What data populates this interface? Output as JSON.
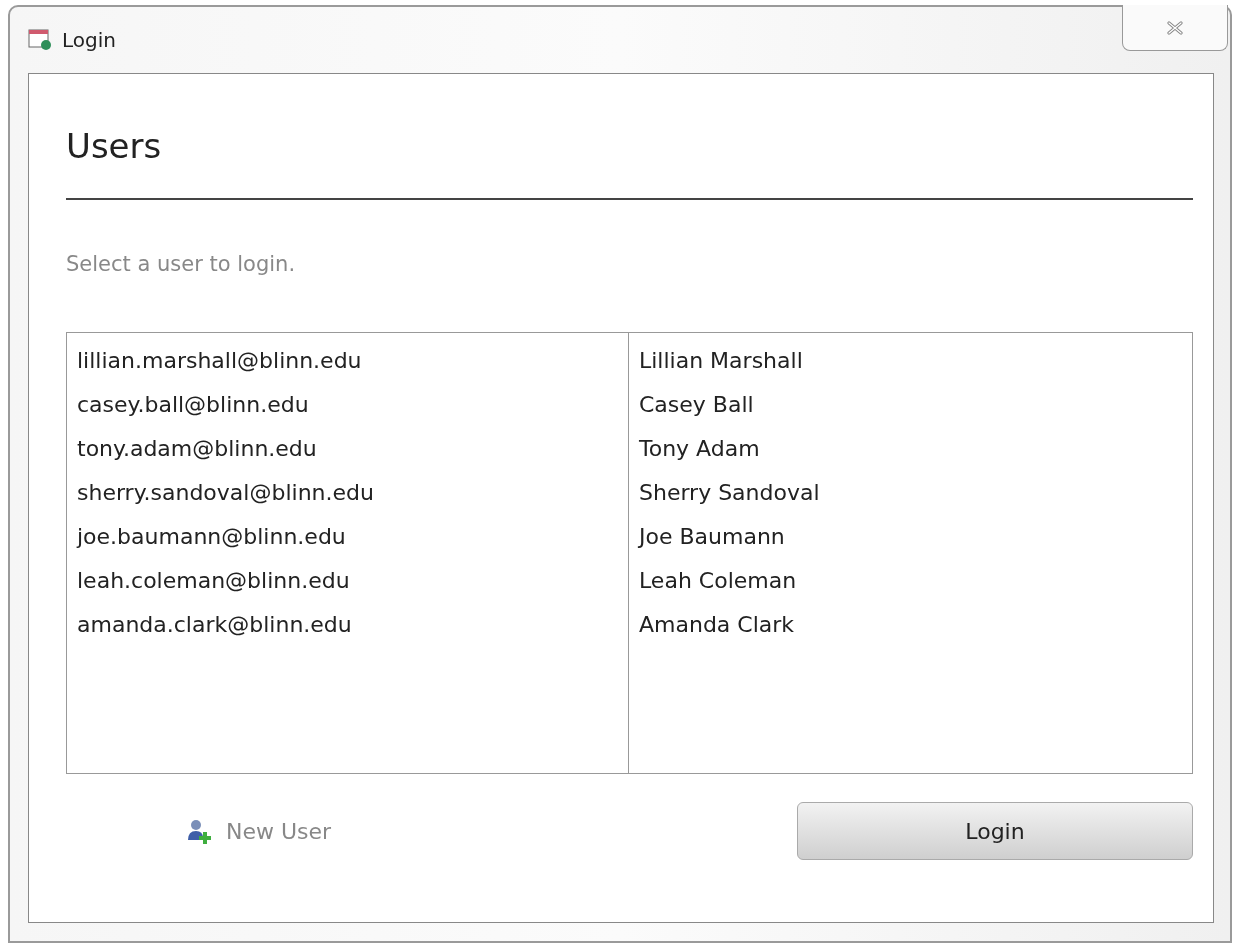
{
  "window": {
    "title": "Login"
  },
  "heading": "Users",
  "instruction": "Select a user to login.",
  "users": [
    {
      "email": "lillian.marshall@blinn.edu",
      "name": "Lillian Marshall"
    },
    {
      "email": "casey.ball@blinn.edu",
      "name": "Casey Ball"
    },
    {
      "email": "tony.adam@blinn.edu",
      "name": "Tony Adam"
    },
    {
      "email": "sherry.sandoval@blinn.edu",
      "name": "Sherry Sandoval"
    },
    {
      "email": "joe.baumann@blinn.edu",
      "name": "Joe Baumann"
    },
    {
      "email": "leah.coleman@blinn.edu",
      "name": "Leah Coleman"
    },
    {
      "email": "amanda.clark@blinn.edu",
      "name": "Amanda Clark"
    }
  ],
  "new_user_button": {
    "label": "New User",
    "disabled": true
  },
  "login_button": {
    "label": "Login"
  }
}
